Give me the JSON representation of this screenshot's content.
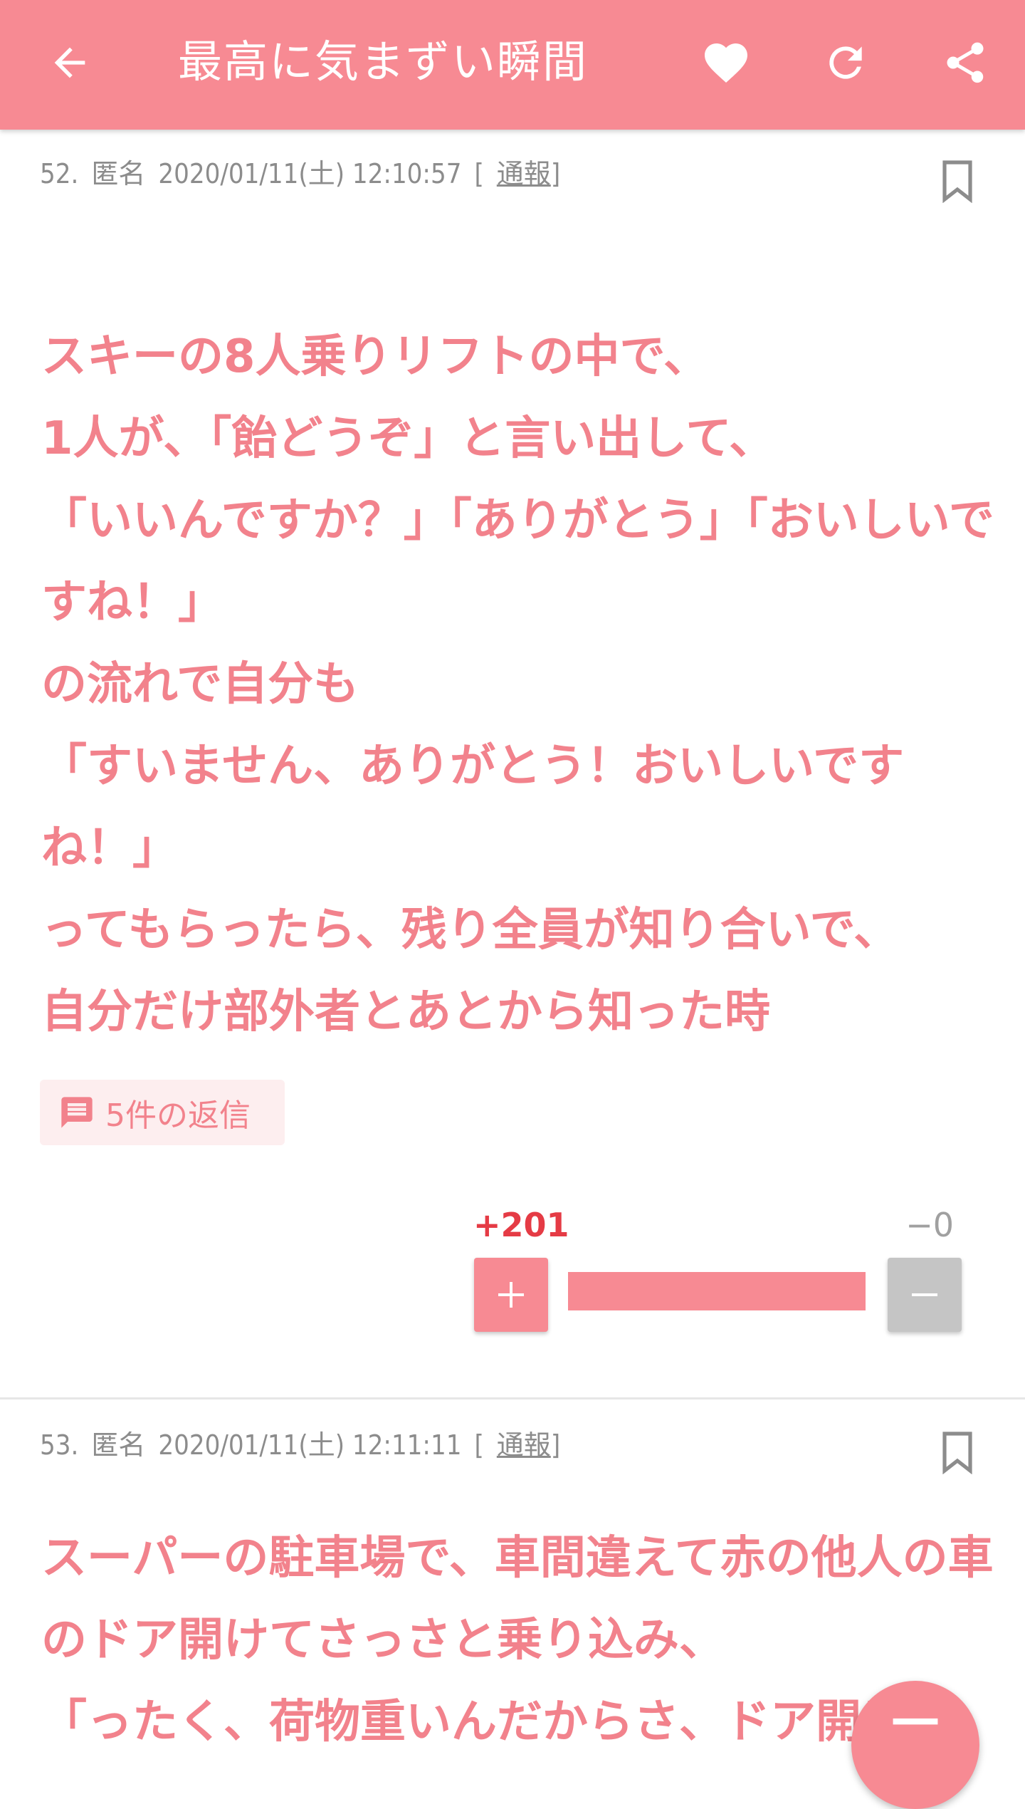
{
  "appbar": {
    "title": "最高に気まずい瞬間",
    "icons": [
      "back-arrow-icon",
      "heart-icon",
      "refresh-icon",
      "share-icon"
    ],
    "color": "#f78a93"
  },
  "posts": [
    {
      "number": "52.",
      "author": "匿名",
      "timestamp": "2020/01/11(土) 12:10:57",
      "report_label": "通報",
      "body": "スキーの8人乗りリフトの中で、\n1人が、「飴どうぞ」と言い出して、\n「いいんですか？」「ありがとう」「おいしいですね！」\nの流れで自分も\n「すいません、ありがとう！おいしいですね！」\nってもらったら、残り全員が知り合いで、\n自分だけ部外者とあとから知った時",
      "replies_label": "5件の返信",
      "votes": {
        "plus_label": "+201",
        "minus_label": "−0",
        "plus": 201,
        "minus": 0,
        "plus_ratio": 1.0
      }
    },
    {
      "number": "53.",
      "author": "匿名",
      "timestamp": "2020/01/11(土) 12:11:11",
      "report_label": "通報",
      "body": "スーパーの駐車場で、車間違えて赤の他人の車のドア開けてさっさと乗り込み、\n「ったく、荷物重いんだからさ、ドア開け"
    }
  ],
  "colors": {
    "accent": "#f78a93",
    "text_pink": "#f2828c",
    "plus_count": "#e53b45",
    "minus_gray": "#c5c5c5"
  }
}
